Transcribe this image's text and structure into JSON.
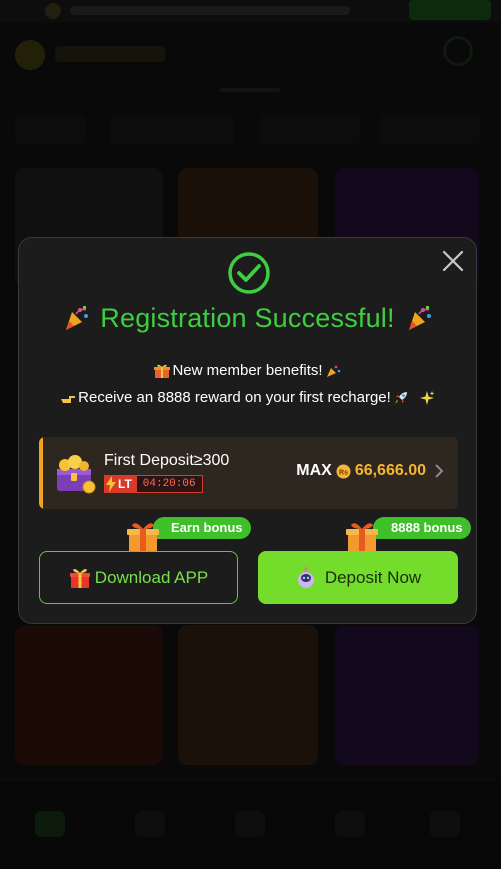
{
  "modal": {
    "title": "Registration Successful!",
    "benefits_line": "New member benefits!",
    "reward_line": "Receive an 8888 reward on your first recharge!",
    "deposit_offer": {
      "label": "First Deposit≥300",
      "lt_tag": "LT",
      "timer": "04:20:06",
      "max_label": "MAX",
      "max_amount": "66,666.00",
      "currency_symbol": "Rs"
    },
    "left_badge": "Earn bonus",
    "right_badge": "8888 bonus",
    "download_label": "Download APP",
    "deposit_label": "Deposit Now"
  },
  "colors": {
    "accent_green": "#3fce3f",
    "button_green": "#74dd2b",
    "amount_gold": "#f7b533",
    "timer_red": "#d93a2a"
  },
  "icons": [
    "check-circle-icon",
    "party-popper-icon",
    "gift-icon",
    "pointing-hand-icon",
    "rocket-icon",
    "sparkles-icon",
    "treasure-icon",
    "lightning-icon",
    "rupee-coin-icon",
    "chevron-right-icon",
    "close-icon",
    "robot-icon"
  ]
}
